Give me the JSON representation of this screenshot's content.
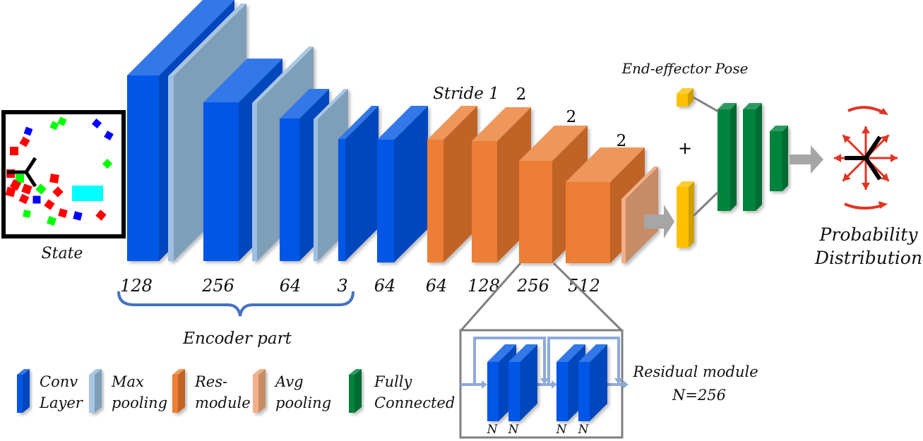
{
  "colors": {
    "conv": {
      "front": "#0057e7",
      "side": "#0046bd",
      "top": "#3378e8"
    },
    "maxpool": {
      "front": "#7f9fb8",
      "side": "#7f9fb8",
      "top": "#a9c6e4",
      "edge": "#9dbfe2"
    },
    "res": {
      "front": "#ec7e34",
      "side": "#c06428",
      "top": "#ef965a"
    },
    "avgpool": {
      "front": "#c68c66",
      "side": "#c68c66",
      "top": "#f1b08a"
    },
    "fc": {
      "front": "#00843e",
      "side": "#006b32",
      "top": "#2e9a62"
    },
    "pose": {
      "front": "#ffc000",
      "side": "#d19e00",
      "top": "#ffcc33"
    },
    "arrow": "#a6a6a6",
    "brace": "#4472c4",
    "red": "#e03424"
  },
  "state": {
    "label": "State"
  },
  "layer_sizes": [
    "128",
    "256",
    "64",
    "3",
    "64",
    "64",
    "128",
    "256",
    "512"
  ],
  "encoder": {
    "label": "Encoder part"
  },
  "strides": {
    "first": "Stride 1",
    "second": "2",
    "third": "2",
    "fourth": "2"
  },
  "end_effector": {
    "label": "End-effector Pose",
    "plus": "+"
  },
  "output": {
    "line1": "Probability",
    "line2": "Distribution"
  },
  "residual": {
    "label": "Residual module",
    "n_value": "N=256",
    "n_label": "N"
  },
  "legend": [
    {
      "line1": "Conv",
      "line2": "Layer",
      "type": "conv"
    },
    {
      "line1": "Max",
      "line2": "pooling",
      "type": "maxpool"
    },
    {
      "line1": "Res-",
      "line2": "module",
      "type": "res"
    },
    {
      "line1": "Avg",
      "line2": "pooling",
      "type": "avgpool"
    },
    {
      "line1": "Fully",
      "line2": "Connected",
      "type": "fc"
    }
  ]
}
